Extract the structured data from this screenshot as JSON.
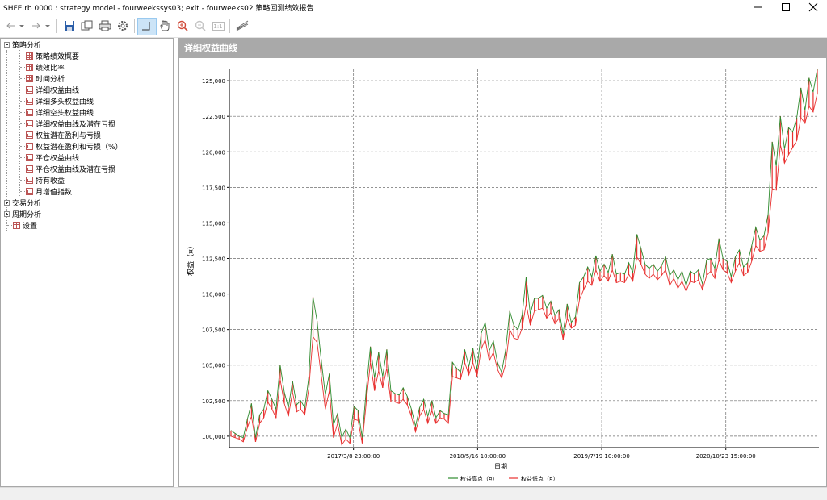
{
  "window": {
    "title": "SHFE.rb 0000 : strategy model - fourweekssys03; exit - fourweeks02 策略回测绩效报告"
  },
  "toolbar": {
    "icons": [
      "back-icon",
      "dropdown-icon",
      "forward-icon",
      "dropdown-icon",
      "save-icon",
      "copy-icon",
      "print-icon",
      "settings-icon",
      "crosshair-icon",
      "pan-hand-icon",
      "zoom-in-icon",
      "zoom-out-icon",
      "zoom-reset-icon",
      "chart-style-icon"
    ],
    "zoom_reset_label": "1:1"
  },
  "tree": {
    "root": {
      "label": "策略分析",
      "expanded": true
    },
    "children": [
      {
        "label": "策略绩效概要",
        "icon": "grid-icon"
      },
      {
        "label": "绩效比率",
        "icon": "grid-icon"
      },
      {
        "label": "时间分析",
        "icon": "grid-icon"
      },
      {
        "label": "详细权益曲线",
        "icon": "chart-icon",
        "selected": true
      },
      {
        "label": "详细多头权益曲线",
        "icon": "chart-icon"
      },
      {
        "label": "详细空头权益曲线",
        "icon": "chart-icon"
      },
      {
        "label": "详细权益曲线及潜在亏损",
        "icon": "chart-icon"
      },
      {
        "label": "权益潜在盈利与亏损",
        "icon": "chart-icon"
      },
      {
        "label": "权益潜在盈利和亏损（%）",
        "icon": "chart-icon"
      },
      {
        "label": "平仓权益曲线",
        "icon": "chart-icon"
      },
      {
        "label": "平仓权益曲线及潜在亏损",
        "icon": "chart-icon"
      },
      {
        "label": "持有收益",
        "icon": "chart-icon"
      },
      {
        "label": "月增值指数",
        "icon": "chart-icon"
      }
    ],
    "siblings": [
      {
        "label": "交易分析",
        "expanded": false
      },
      {
        "label": "周期分析",
        "expanded": false
      },
      {
        "label": "设置",
        "icon": "grid-icon"
      }
    ]
  },
  "panel": {
    "title": "详细权益曲线"
  },
  "chart_data": {
    "type": "line",
    "title": "",
    "ylabel": "权益（¤）",
    "xlabel": "日期",
    "ylim": [
      99200,
      125800
    ],
    "y_ticks": [
      "100,000",
      "102,500",
      "105,000",
      "107,500",
      "110,000",
      "112,500",
      "115,000",
      "117,500",
      "120,000",
      "122,500",
      "125,000"
    ],
    "y_tick_values": [
      100000,
      102500,
      105000,
      107500,
      110000,
      112500,
      115000,
      117500,
      120000,
      122500,
      125000
    ],
    "x_tick_labels": [
      "2017/3/8 23:00:00",
      "2018/5/16 10:00:00",
      "2019/7/19 10:00:00",
      "2020/10/23 15:00:00"
    ],
    "grid": true,
    "legend_position": "bottom-center",
    "series": [
      {
        "name": "权益高点（¤）",
        "color": "#2e8b2e",
        "values": [
          100400,
          100200,
          100000,
          99900,
          101200,
          102300,
          99900,
          101500,
          101900,
          103200,
          102600,
          101900,
          105000,
          103100,
          102000,
          103900,
          102200,
          102500,
          102000,
          104200,
          109800,
          108100,
          105400,
          102900,
          104400,
          100800,
          101600,
          99900,
          100500,
          99900,
          102100,
          101800,
          99900,
          103300,
          106300,
          104100,
          105900,
          104200,
          106100,
          103200,
          103000,
          102900,
          103400,
          102800,
          101900,
          100700,
          102000,
          102600,
          101400,
          102500,
          101300,
          101800,
          101600,
          101500,
          105200,
          104800,
          104500,
          106100,
          104900,
          106200,
          104700,
          107200,
          108000,
          106000,
          106700,
          105200,
          104500,
          106100,
          108800,
          107800,
          107500,
          108500,
          111200,
          108600,
          109700,
          109700,
          109900,
          109000,
          109500,
          108500,
          108900,
          107200,
          109300,
          108000,
          108400,
          110800,
          111200,
          111900,
          111200,
          112700,
          111600,
          112100,
          111500,
          112800,
          111400,
          111500,
          111400,
          112200,
          111500,
          114200,
          113200,
          112100,
          111800,
          112100,
          111600,
          112000,
          112600,
          111300,
          111700,
          111000,
          111600,
          110600,
          111600,
          111400,
          111700,
          110700,
          112400,
          112500,
          111800,
          113900,
          112500,
          112300,
          111200,
          112600,
          113100,
          111900,
          112200,
          113400,
          114700,
          113800,
          114100,
          115600,
          120700,
          119000,
          122500,
          120200,
          121700,
          121400,
          122400,
          124500,
          122900,
          125200,
          124200,
          125800
        ]
      },
      {
        "name": "权益低点（¤）",
        "color": "#e8302f",
        "values": [
          100000,
          99900,
          99800,
          99600,
          100600,
          101400,
          99600,
          100900,
          101300,
          102400,
          101900,
          101300,
          104000,
          102300,
          101400,
          103100,
          101700,
          101900,
          101500,
          103400,
          107000,
          106600,
          104300,
          101900,
          103200,
          99900,
          100900,
          99400,
          99800,
          99500,
          101200,
          101100,
          99500,
          102400,
          105200,
          103200,
          104600,
          103400,
          104800,
          102400,
          102400,
          102300,
          102600,
          102200,
          101400,
          100300,
          101400,
          101900,
          100900,
          101800,
          100900,
          101300,
          101200,
          100900,
          104200,
          104100,
          104000,
          105200,
          104300,
          105200,
          104200,
          106100,
          106800,
          105300,
          105900,
          104700,
          104100,
          105100,
          107500,
          106900,
          106800,
          107600,
          109300,
          107800,
          108800,
          108900,
          109000,
          108300,
          108700,
          107900,
          108300,
          106800,
          108300,
          107600,
          107800,
          109600,
          110300,
          110900,
          110600,
          111700,
          110900,
          111300,
          110900,
          111700,
          110800,
          110900,
          110800,
          111400,
          110900,
          112600,
          112100,
          111400,
          111100,
          111400,
          111000,
          111300,
          111700,
          110600,
          111100,
          110400,
          110900,
          110200,
          110900,
          110800,
          111000,
          110300,
          111300,
          111600,
          111100,
          112400,
          111700,
          111500,
          110800,
          111600,
          112200,
          111300,
          111500,
          112300,
          113400,
          113000,
          113100,
          114300,
          117400,
          117300,
          120500,
          119200,
          119800,
          120300,
          120800,
          122400,
          122000,
          123200,
          122800,
          124100
        ]
      }
    ]
  }
}
